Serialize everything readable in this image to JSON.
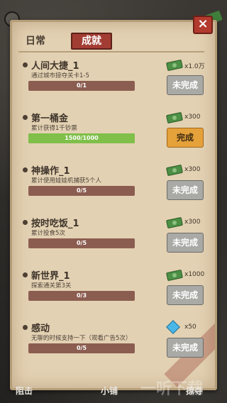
{
  "tabs": {
    "daily": "日常",
    "achievements": "成就"
  },
  "close_icon": "×",
  "quests": [
    {
      "title": "人间大捷_1",
      "desc": "通过城市掠夺关卡1-5",
      "progress_text": "0/1",
      "progress": 0,
      "reward_icon": "cash-icon",
      "reward": "x1.0万",
      "button": "未完成",
      "state": "pending"
    },
    {
      "title": "第一桶金",
      "desc": "累计获得1千钞票",
      "progress_text": "1500/1000",
      "progress": 1,
      "reward_icon": "cash-icon",
      "reward": "x300",
      "button": "完成",
      "state": "done"
    },
    {
      "title": "神操作_1",
      "desc": "累计使用娃娃机捕获5个人",
      "progress_text": "0/5",
      "progress": 0,
      "reward_icon": "cash-icon",
      "reward": "x300",
      "button": "未完成",
      "state": "pending"
    },
    {
      "title": "按时吃饭_1",
      "desc": "累计投食5次",
      "progress_text": "0/5",
      "progress": 0,
      "reward_icon": "cash-icon",
      "reward": "x300",
      "button": "未完成",
      "state": "pending"
    },
    {
      "title": "新世界_1",
      "desc": "探索通关第3关",
      "progress_text": "0/3",
      "progress": 0,
      "reward_icon": "cash-icon",
      "reward": "x1000",
      "button": "未完成",
      "state": "pending"
    },
    {
      "title": "感动",
      "desc": "无聊的时候支持一下（观看广告5次）",
      "progress_text": "0/5",
      "progress": 0,
      "reward_icon": "gem-icon",
      "reward": "x50",
      "button": "未完成",
      "state": "pending"
    }
  ],
  "bottom": {
    "left": "阻击",
    "middle": "小铺",
    "right": "掠夺"
  },
  "watermark": "一听下载",
  "colors": {
    "panel": "#e3d1b3",
    "accent_red": "#a23d33",
    "complete_orange": "#e5a13a",
    "bar_bg": "#8b5d50",
    "bar_fill": "#7fbf4a"
  }
}
